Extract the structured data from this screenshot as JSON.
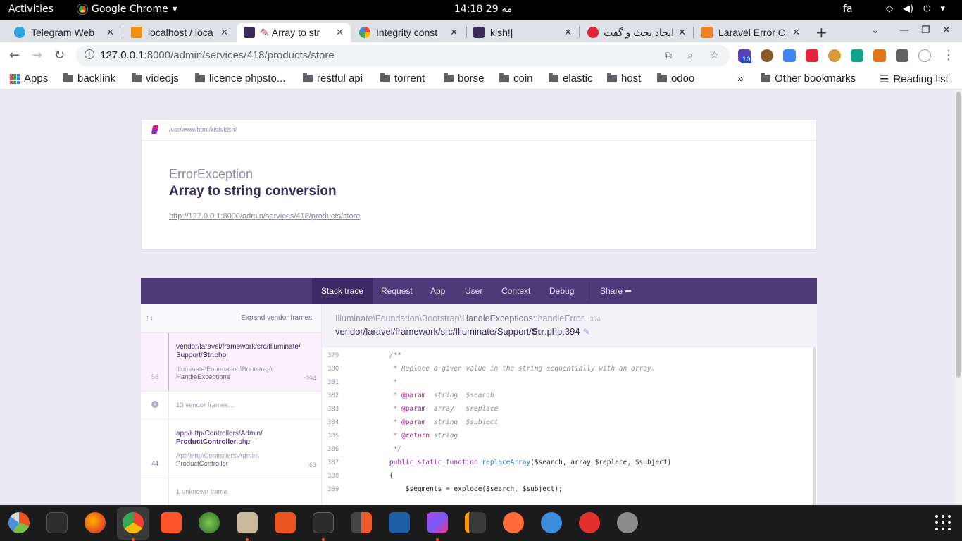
{
  "topbar": {
    "activities": "Activities",
    "app_name": "Google Chrome",
    "clock": "14:18  29 مه",
    "lang": "fa"
  },
  "tabs": [
    {
      "title": "Telegram Web",
      "color": "#2ca5e0"
    },
    {
      "title": "localhost / loca",
      "color": "#f29111"
    },
    {
      "title": "Array to str",
      "color": "#e5243b"
    },
    {
      "title": "Integrity const",
      "color": "#4285f4"
    },
    {
      "title": "kish!|",
      "color": "#3a2a5c"
    },
    {
      "title": "ایجاد بحث و گفت",
      "color": "#e5243b"
    },
    {
      "title": "Laravel Error C",
      "color": "#f48024"
    }
  ],
  "address": {
    "host": "127.0.0.1",
    "path": ":8000/admin/services/418/products/store"
  },
  "bookmarks": {
    "apps": "Apps",
    "items": [
      "backlink",
      "videojs",
      "licence phpsto...",
      "restful api",
      "torrent",
      "borse",
      "coin",
      "elastic",
      "host",
      "odoo"
    ],
    "overflow": "»",
    "other": "Other bookmarks",
    "reading": "Reading list"
  },
  "error": {
    "root_path": "/var/www/html/kish/kish/",
    "exception_class": "ErrorException",
    "message": "Array to string conversion",
    "url": "http://127.0.0.1:8000/admin/services/418/products/store"
  },
  "nav": {
    "items": [
      "Stack trace",
      "Request",
      "App",
      "User",
      "Context",
      "Debug"
    ],
    "share": "Share"
  },
  "frames_panel": {
    "expand_vendor": "Expand vendor frames",
    "frames": [
      {
        "num": "58",
        "file_dir": "vendor/laravel/framework/src/Illuminate/",
        "file_dir2": "Support/",
        "file_name": "Str",
        "file_ext": ".php",
        "class_ns": "Illuminate\\Foundation\\Bootstrap\\",
        "class_name": "HandleExceptions",
        "line": ":394"
      },
      {
        "vendor_text": "13 vendor frames…"
      },
      {
        "num": "44",
        "file_dir": "app/Http/Controllers/Admin/",
        "file_name": "ProductController",
        "file_ext": ".php",
        "class_ns": "App\\Http\\Controllers\\Admin\\",
        "class_name": "ProductController",
        "line": ":63"
      },
      {
        "unknown_text": "1 unknown frame"
      }
    ]
  },
  "code_panel": {
    "fqn_ns": "Illuminate\\Foundation\\Bootstrap\\",
    "fqn_class": "HandleExceptions",
    "fqn_method": "::handleError",
    "fqn_line": ":394",
    "file_dir": "vendor/laravel/framework/src/Illuminate/Support/",
    "file_name": "Str",
    "file_rest": ".php:394",
    "lines": [
      {
        "n": "379",
        "parts": [
          {
            "c": "cm",
            "t": "    /**"
          }
        ]
      },
      {
        "n": "380",
        "parts": [
          {
            "c": "cm",
            "t": "     * Replace a given value in the string sequentially with an array."
          }
        ]
      },
      {
        "n": "381",
        "parts": [
          {
            "c": "cm",
            "t": "     *"
          }
        ]
      },
      {
        "n": "382",
        "parts": [
          {
            "c": "cm",
            "t": "     * "
          },
          {
            "c": "tag",
            "t": "@param"
          },
          {
            "c": "cm",
            "t": "  string  $search"
          }
        ]
      },
      {
        "n": "383",
        "parts": [
          {
            "c": "cm",
            "t": "     * "
          },
          {
            "c": "tag",
            "t": "@param"
          },
          {
            "c": "cm",
            "t": "  array   $replace"
          }
        ]
      },
      {
        "n": "384",
        "parts": [
          {
            "c": "cm",
            "t": "     * "
          },
          {
            "c": "tag",
            "t": "@param"
          },
          {
            "c": "cm",
            "t": "  string  $subject"
          }
        ]
      },
      {
        "n": "385",
        "parts": [
          {
            "c": "cm",
            "t": "     * "
          },
          {
            "c": "tag",
            "t": "@return"
          },
          {
            "c": "cm",
            "t": " string"
          }
        ]
      },
      {
        "n": "386",
        "parts": [
          {
            "c": "cm",
            "t": "     */"
          }
        ]
      },
      {
        "n": "387",
        "parts": [
          {
            "c": "kw",
            "t": "    public static function "
          },
          {
            "c": "fn",
            "t": "replaceArray"
          },
          {
            "c": "",
            "t": "($search, array $replace, $subject)"
          }
        ]
      },
      {
        "n": "388",
        "parts": [
          {
            "c": "",
            "t": "    {"
          }
        ]
      },
      {
        "n": "389",
        "parts": [
          {
            "c": "",
            "t": "        $segments = explode($search, $subject);"
          }
        ]
      }
    ]
  },
  "ext_badge": "10"
}
